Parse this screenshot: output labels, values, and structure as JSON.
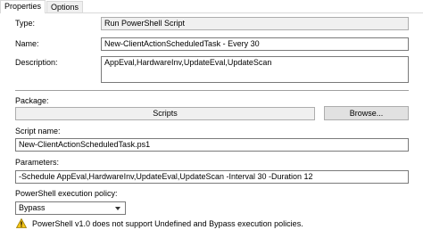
{
  "tabs": [
    {
      "label": "Properties",
      "active": true
    },
    {
      "label": "Options",
      "active": false
    }
  ],
  "type": {
    "label": "Type:",
    "value": "Run PowerShell Script"
  },
  "name": {
    "label": "Name:",
    "value": "New-ClientActionScheduledTask - Every 30"
  },
  "description": {
    "label": "Description:",
    "value": "AppEval,HardwareInv,UpdateEval,UpdateScan"
  },
  "package": {
    "label": "Package:",
    "value": "Scripts",
    "browse_label": "Browse..."
  },
  "script_name": {
    "label": "Script name:",
    "value": "New-ClientActionScheduledTask.ps1"
  },
  "parameters": {
    "label": "Parameters:",
    "value": "-Schedule AppEval,HardwareInv,UpdateEval,UpdateScan -Interval 30 -Duration 12"
  },
  "execution_policy": {
    "label": "PowerShell execution policy:",
    "selected": "Bypass",
    "warning": "PowerShell v1.0 does not support Undefined and Bypass execution policies.",
    "warning_icon": "warning-triangle-icon"
  },
  "colors": {
    "warning_fill": "#f5c518",
    "separator": "#a0a0a0"
  }
}
